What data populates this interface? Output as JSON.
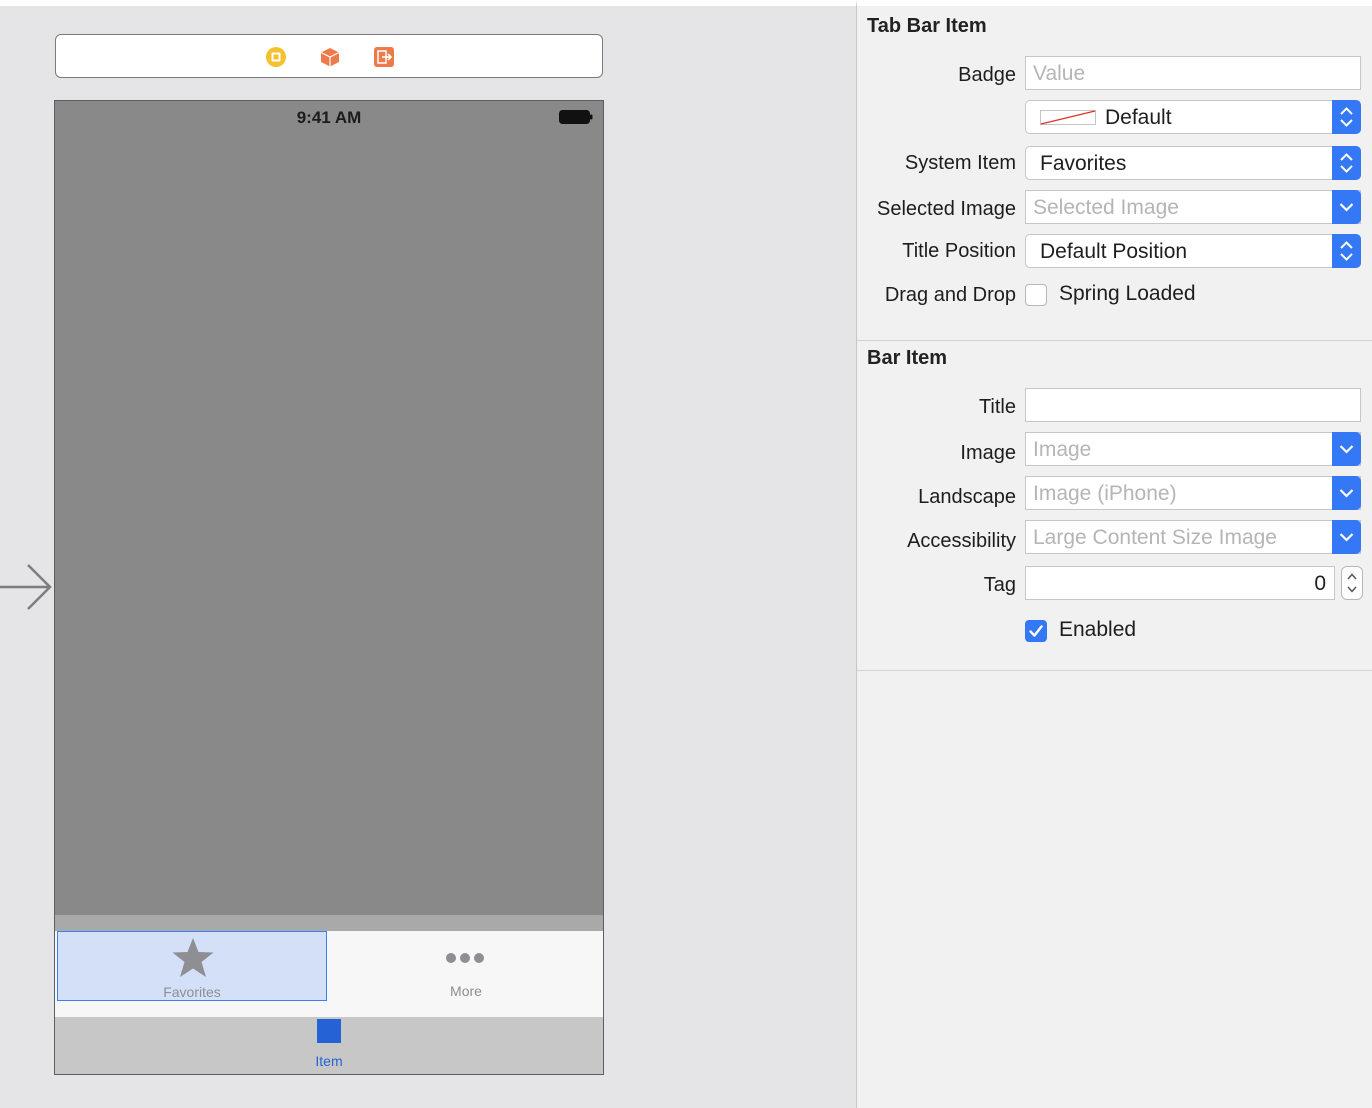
{
  "canvas": {
    "status_time": "9:41 AM",
    "tabs": [
      {
        "label": "Favorites",
        "icon": "star-icon",
        "selected": true
      },
      {
        "label": "More",
        "icon": "more-icon",
        "selected": false
      }
    ],
    "bottom_item_label": "Item",
    "dock_icons": [
      "view-controller-icon",
      "first-responder-icon",
      "exit-icon"
    ]
  },
  "inspector": {
    "tab_bar_item": {
      "title": "Tab Bar Item",
      "badge_label": "Badge",
      "badge_placeholder": "Value",
      "badge_color": "Default",
      "system_item_label": "System Item",
      "system_item_value": "Favorites",
      "selected_image_label": "Selected Image",
      "selected_image_placeholder": "Selected Image",
      "title_position_label": "Title Position",
      "title_position_value": "Default Position",
      "drag_drop_label": "Drag and Drop",
      "spring_loaded_label": "Spring Loaded",
      "spring_loaded_checked": false
    },
    "bar_item": {
      "title": "Bar Item",
      "title_label": "Title",
      "title_value": "",
      "image_label": "Image",
      "image_placeholder": "Image",
      "landscape_label": "Landscape",
      "landscape_placeholder": "Image (iPhone)",
      "accessibility_label": "Accessibility",
      "accessibility_placeholder": "Large Content Size Image",
      "tag_label": "Tag",
      "tag_value": "0",
      "enabled_label": "Enabled",
      "enabled_checked": true
    }
  },
  "colors": {
    "accent": "#3478f6",
    "tab_tint": "#2463d4",
    "selection_fill": "#d3e0f7",
    "dock_yellow": "#f5c22e",
    "dock_orange": "#ee7a4a"
  }
}
